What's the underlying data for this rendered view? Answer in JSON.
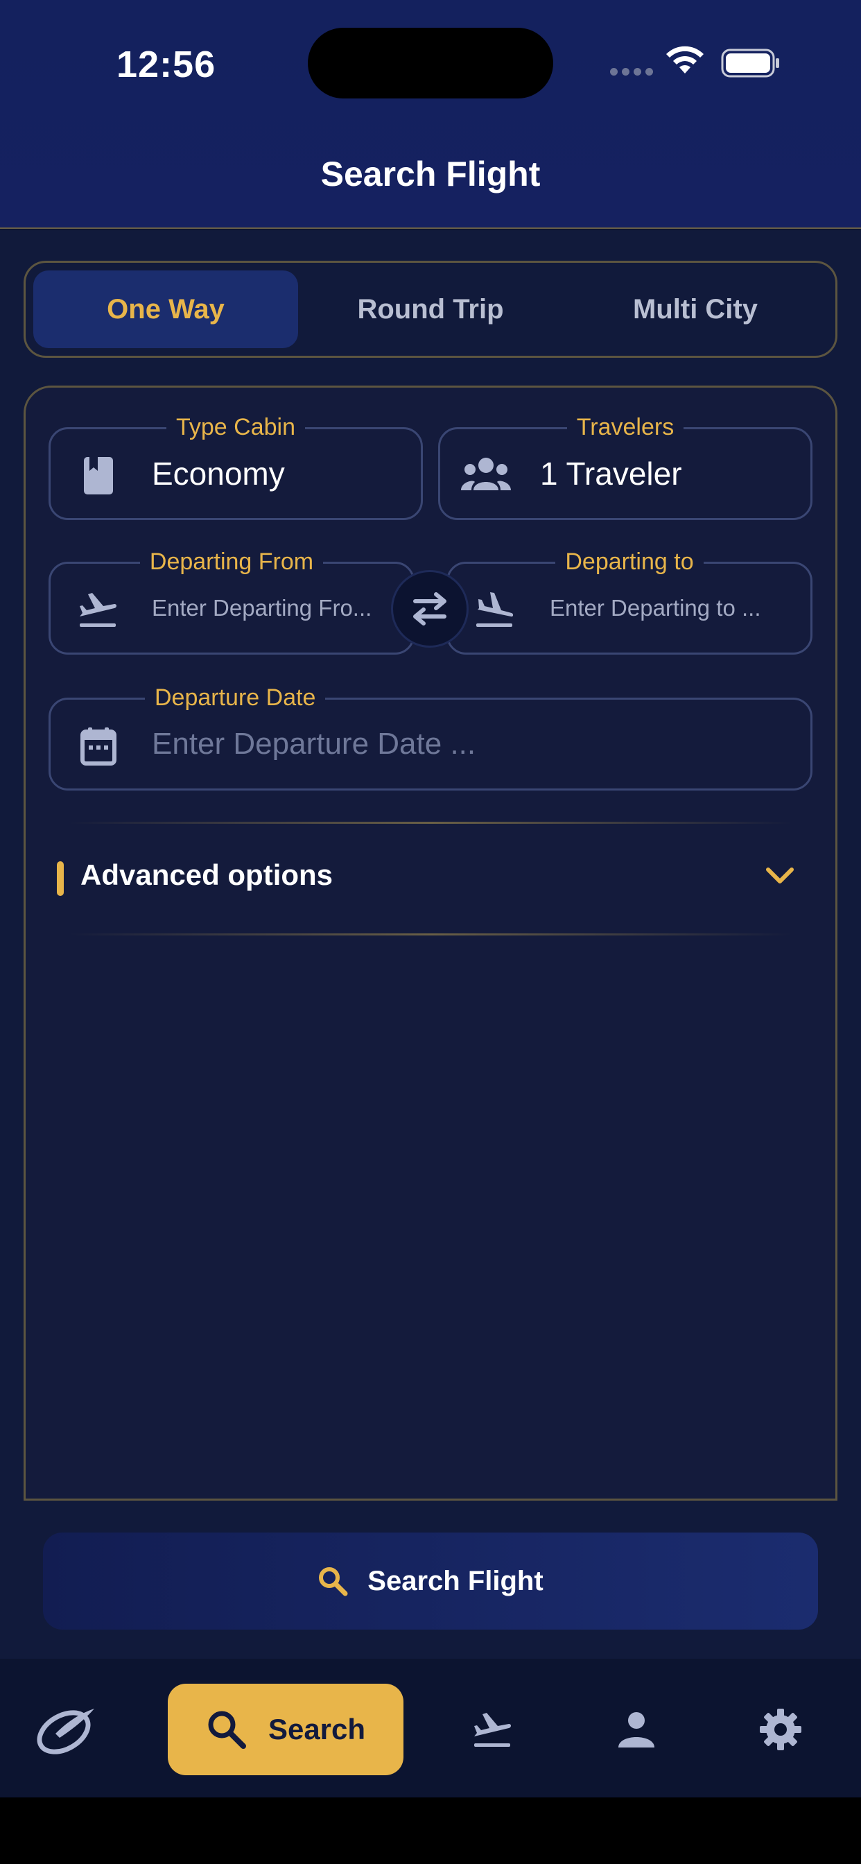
{
  "status_bar": {
    "time": "12:56"
  },
  "header": {
    "title": "Search Flight"
  },
  "trip_tabs": [
    {
      "label": "One Way",
      "active": true
    },
    {
      "label": "Round Trip",
      "active": false
    },
    {
      "label": "Multi City",
      "active": false
    }
  ],
  "form": {
    "cabin": {
      "legend": "Type Cabin",
      "value": "Economy",
      "icon": "cabin-book-icon"
    },
    "travelers": {
      "legend": "Travelers",
      "value": "1 Traveler",
      "icon": "group-icon"
    },
    "from": {
      "legend": "Departing From",
      "placeholder": "Enter Departing Fro...",
      "icon": "takeoff-icon"
    },
    "to": {
      "legend": "Departing to",
      "placeholder": "Enter Departing to ...",
      "icon": "landing-icon"
    },
    "date": {
      "legend": "Departure Date",
      "placeholder": "Enter Departure Date ...",
      "icon": "calendar-icon"
    },
    "advanced": {
      "label": "Advanced options"
    }
  },
  "search_button": {
    "label": "Search Flight"
  },
  "bottom_nav": {
    "items": [
      {
        "name": "logo",
        "icon": "logo-icon"
      },
      {
        "name": "search",
        "label": "Search",
        "icon": "search-icon",
        "active": true
      },
      {
        "name": "flights",
        "icon": "takeoff-icon"
      },
      {
        "name": "profile",
        "icon": "person-icon"
      },
      {
        "name": "settings",
        "icon": "gear-icon"
      }
    ]
  },
  "colors": {
    "accent": "#e8b54a",
    "header_bg": "#14215e",
    "card_bg": "#141b3c",
    "active_tab_bg": "#1b2d6e",
    "field_border": "#3a4673",
    "frame_border": "#5c5540"
  }
}
